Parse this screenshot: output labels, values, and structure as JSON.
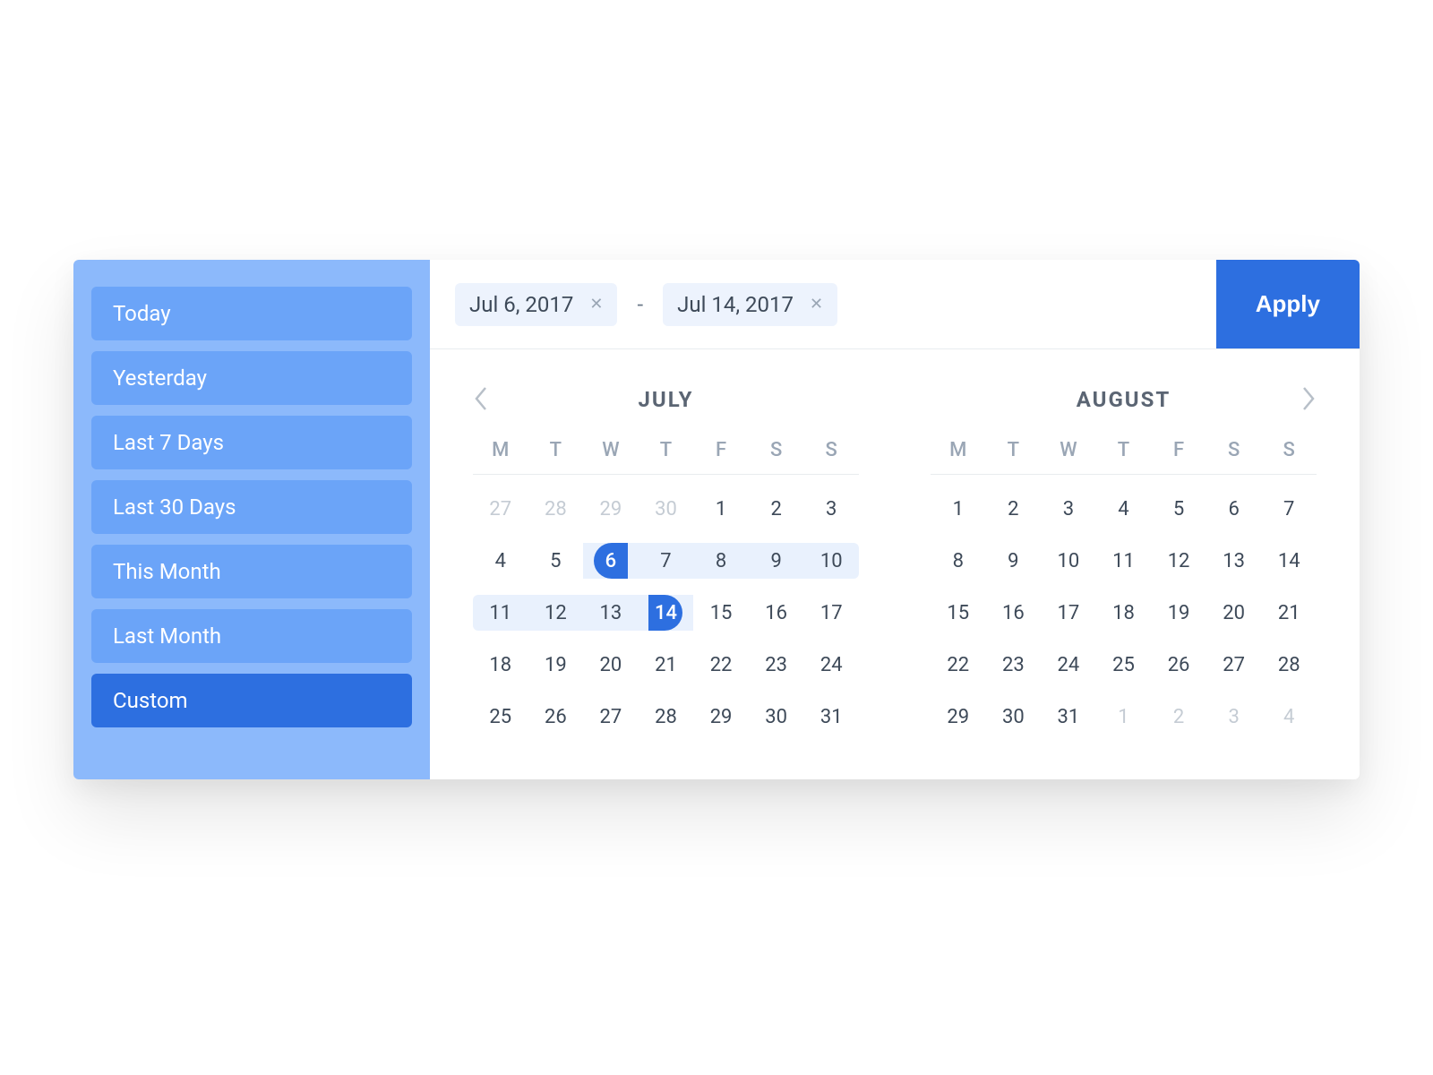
{
  "sidebar": {
    "presets": [
      {
        "label": "Today",
        "active": false
      },
      {
        "label": "Yesterday",
        "active": false
      },
      {
        "label": "Last 7 Days",
        "active": false
      },
      {
        "label": "Last 30 Days",
        "active": false
      },
      {
        "label": "This Month",
        "active": false
      },
      {
        "label": "Last Month",
        "active": false
      },
      {
        "label": "Custom",
        "active": true
      }
    ]
  },
  "topbar": {
    "start_chip": "Jul 6, 2017",
    "end_chip": "Jul 14, 2017",
    "separator": "-",
    "apply_label": "Apply"
  },
  "dow": [
    "M",
    "T",
    "W",
    "T",
    "F",
    "S",
    "S"
  ],
  "months": [
    {
      "title": "JULY",
      "nav": "prev",
      "days": [
        {
          "n": 27,
          "other": true
        },
        {
          "n": 28,
          "other": true
        },
        {
          "n": 29,
          "other": true
        },
        {
          "n": 30,
          "other": true
        },
        {
          "n": 1
        },
        {
          "n": 2
        },
        {
          "n": 3
        },
        {
          "n": 4
        },
        {
          "n": 5
        },
        {
          "n": 6,
          "start": true
        },
        {
          "n": 7,
          "in": true
        },
        {
          "n": 8,
          "in": true
        },
        {
          "n": 9,
          "in": true
        },
        {
          "n": 10,
          "in": true,
          "rr": true
        },
        {
          "n": 11,
          "in": true,
          "rl": true
        },
        {
          "n": 12,
          "in": true
        },
        {
          "n": 13,
          "in": true
        },
        {
          "n": 14,
          "end": true
        },
        {
          "n": 15
        },
        {
          "n": 16
        },
        {
          "n": 17
        },
        {
          "n": 18
        },
        {
          "n": 19
        },
        {
          "n": 20
        },
        {
          "n": 21
        },
        {
          "n": 22
        },
        {
          "n": 23
        },
        {
          "n": 24
        },
        {
          "n": 25
        },
        {
          "n": 26
        },
        {
          "n": 27
        },
        {
          "n": 28
        },
        {
          "n": 29
        },
        {
          "n": 30
        },
        {
          "n": 31
        }
      ]
    },
    {
      "title": "AUGUST",
      "nav": "next",
      "days": [
        {
          "n": 1
        },
        {
          "n": 2
        },
        {
          "n": 3
        },
        {
          "n": 4
        },
        {
          "n": 5
        },
        {
          "n": 6
        },
        {
          "n": 7
        },
        {
          "n": 8
        },
        {
          "n": 9
        },
        {
          "n": 10
        },
        {
          "n": 11
        },
        {
          "n": 12
        },
        {
          "n": 13
        },
        {
          "n": 14
        },
        {
          "n": 15
        },
        {
          "n": 16
        },
        {
          "n": 17
        },
        {
          "n": 18
        },
        {
          "n": 19
        },
        {
          "n": 20
        },
        {
          "n": 21
        },
        {
          "n": 22
        },
        {
          "n": 23
        },
        {
          "n": 24
        },
        {
          "n": 25
        },
        {
          "n": 26
        },
        {
          "n": 27
        },
        {
          "n": 28
        },
        {
          "n": 29
        },
        {
          "n": 30
        },
        {
          "n": 31
        },
        {
          "n": 1,
          "other": true
        },
        {
          "n": 2,
          "other": true
        },
        {
          "n": 3,
          "other": true
        },
        {
          "n": 4,
          "other": true
        }
      ]
    }
  ],
  "colors": {
    "sidebar_bg": "#8cb9fb",
    "preset_bg": "#6ba4f8",
    "primary": "#2d6fe0",
    "range_bg": "#e9f1fd",
    "chip_bg": "#edf3fd"
  }
}
